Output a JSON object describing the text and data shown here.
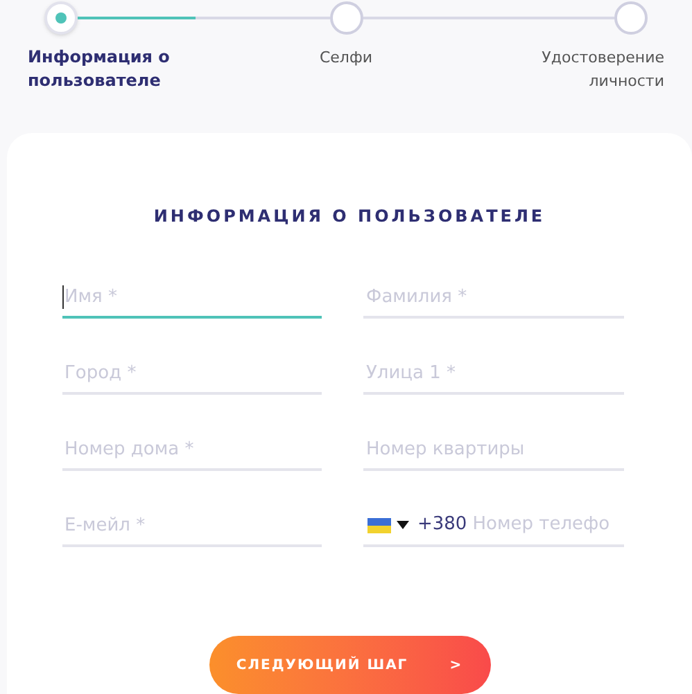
{
  "stepper": {
    "progress": {
      "level": 0.47
    },
    "steps": [
      {
        "label": "Информация о пользователе",
        "selected": true
      },
      {
        "label": "Селфи",
        "selected": false
      },
      {
        "label": "Удостоверение личности",
        "selected": false
      }
    ]
  },
  "form": {
    "title": "ИНФОРМАЦИЯ О ПОЛЬЗОВАТЕЛЕ",
    "fields": [
      {
        "kind": "text",
        "placeholder": "Имя *",
        "focused": true
      },
      {
        "kind": "text",
        "placeholder": "Фамилия *",
        "focused": false
      },
      {
        "kind": "text",
        "placeholder": "Город *",
        "focused": false
      },
      {
        "kind": "text",
        "placeholder": "Улица 1 *",
        "focused": false
      },
      {
        "kind": "text",
        "placeholder": "Номер дома *",
        "focused": false
      },
      {
        "kind": "text",
        "placeholder": "Номер квартиры",
        "focused": false
      },
      {
        "kind": "text",
        "placeholder": "Е-мейл *",
        "focused": false
      },
      {
        "kind": "phone",
        "prefix": "+380",
        "placeholder": "Номер телефо",
        "focused": false
      }
    ],
    "next_button": {
      "label": "СЛЕДУЮЩИЙ ШАГ",
      "arrow": ">"
    }
  }
}
